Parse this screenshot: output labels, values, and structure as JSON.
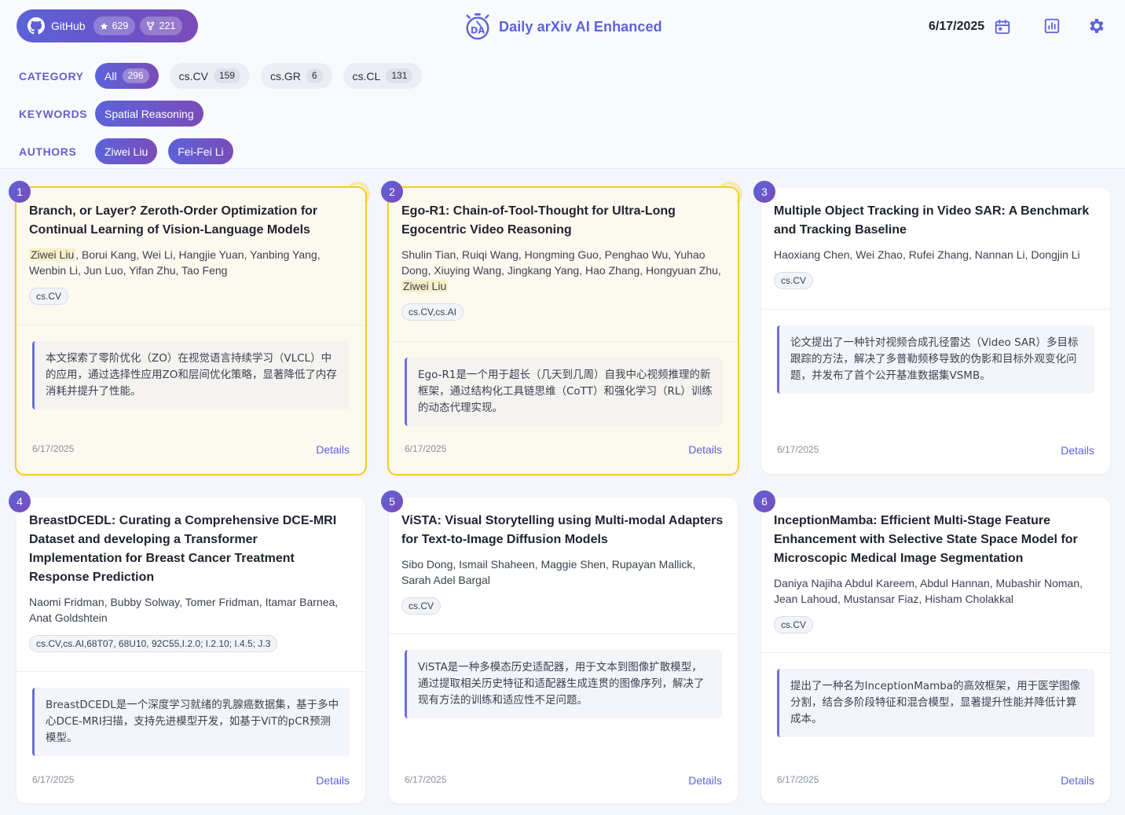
{
  "header": {
    "github": {
      "label": "GitHub",
      "stars": "629",
      "forks": "221"
    },
    "brand": {
      "title": "Daily arXiv AI Enhanced",
      "logo_text": "DA"
    },
    "date": "6/17/2025",
    "icons": {
      "calendar": "calendar-icon",
      "stats": "bar-chart-icon",
      "settings": "gear-icon"
    }
  },
  "filters": {
    "category": {
      "label": "CATEGORY",
      "chips": [
        {
          "label": "All",
          "count": "296",
          "active": true
        },
        {
          "label": "cs.CV",
          "count": "159",
          "active": false
        },
        {
          "label": "cs.GR",
          "count": "6",
          "active": false
        },
        {
          "label": "cs.CL",
          "count": "131",
          "active": false
        }
      ]
    },
    "keywords": {
      "label": "KEYWORDS",
      "chips": [
        {
          "label": "Spatial Reasoning",
          "active": true
        }
      ]
    },
    "authors": {
      "label": "AUTHORS",
      "chips": [
        {
          "label": "Ziwei Liu",
          "active": true
        },
        {
          "label": "Fei-Fei Li",
          "active": true
        }
      ]
    }
  },
  "colors": {
    "accent": "#5b63d9",
    "accent2": "#7a4cb9",
    "highlight_border": "#f5cd22",
    "highlight_bg": "#fcf9ef"
  },
  "cards": [
    {
      "num": "1",
      "title": "Branch, or Layer? Zeroth-Order Optimization for Continual Learning of Vision-Language Models",
      "authors_hl": "Ziwei Liu",
      "authors": ", Borui Kang, Wei Li, Hangjie Yuan, Yanbing Yang, Wenbin Li, Jun Luo, Yifan Zhu, Tao Feng",
      "tag": "cs.CV",
      "summary": "本文探索了零阶优化（ZO）在视觉语言持续学习（VLCL）中的应用，通过选择性应用ZO和层间优化策略，显著降低了内存消耗并提升了性能。",
      "date": "6/17/2025",
      "details": "Details"
    },
    {
      "num": "2",
      "title": "Ego-R1: Chain-of-Tool-Thought for Ultra-Long Egocentric Video Reasoning",
      "authors_pre": "Shulin Tian, Ruiqi Wang, Hongming Guo, Penghao Wu, Yuhao Dong, Xiuying Wang, Jingkang Yang, Hao Zhang, Hongyuan Zhu, ",
      "authors_hl": "Ziwei Liu",
      "tag": "cs.CV,cs.AI",
      "summary": "Ego-R1是一个用于超长（几天到几周）自我中心视频推理的新框架，通过结构化工具链思维（CoTT）和强化学习（RL）训练的动态代理实现。",
      "date": "6/17/2025",
      "details": "Details"
    },
    {
      "num": "3",
      "title": "Multiple Object Tracking in Video SAR: A Benchmark and Tracking Baseline",
      "authors": "Haoxiang Chen, Wei Zhao, Rufei Zhang, Nannan Li, Dongjin Li",
      "tag": "cs.CV",
      "summary": "论文提出了一种针对视频合成孔径雷达（Video SAR）多目标跟踪的方法，解决了多普勒频移导致的伪影和目标外观变化问题，并发布了首个公开基准数据集VSMB。",
      "date": "6/17/2025",
      "details": "Details"
    },
    {
      "num": "4",
      "title": "BreastDCEDL: Curating a Comprehensive DCE-MRI Dataset and developing a Transformer Implementation for Breast Cancer Treatment Response Prediction",
      "authors": "Naomi Fridman, Bubby Solway, Tomer Fridman, Itamar Barnea, Anat Goldshtein",
      "tag": "cs.CV,cs.AI,68T07, 68U10, 92C55,I.2.0; I.2.10; I.4.5; J.3",
      "summary": "BreastDCEDL是一个深度学习就绪的乳腺癌数据集，基于多中心DCE-MRI扫描，支持先进模型开发，如基于ViT的pCR预测模型。",
      "date": "6/17/2025",
      "details": "Details"
    },
    {
      "num": "5",
      "title": "ViSTA: Visual Storytelling using Multi-modal Adapters for Text-to-Image Diffusion Models",
      "authors": "Sibo Dong, Ismail Shaheen, Maggie Shen, Rupayan Mallick, Sarah Adel Bargal",
      "tag": "cs.CV",
      "summary": "ViSTA是一种多模态历史适配器，用于文本到图像扩散模型，通过提取相关历史特征和适配器生成连贯的图像序列，解决了现有方法的训练和适应性不足问题。",
      "date": "6/17/2025",
      "details": "Details"
    },
    {
      "num": "6",
      "title": "InceptionMamba: Efficient Multi-Stage Feature Enhancement with Selective State Space Model for Microscopic Medical Image Segmentation",
      "authors": "Daniya Najiha Abdul Kareem, Abdul Hannan, Mubashir Noman, Jean Lahoud, Mustansar Fiaz, Hisham Cholakkal",
      "tag": "cs.CV",
      "summary": "提出了一种名为InceptionMamba的高效框架，用于医学图像分割，结合多阶段特征和混合模型，显著提升性能并降低计算成本。",
      "date": "6/17/2025",
      "details": "Details"
    }
  ]
}
